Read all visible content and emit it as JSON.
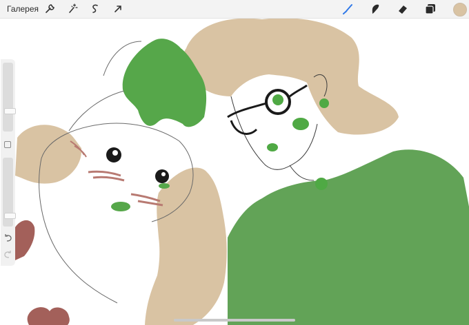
{
  "toolbar": {
    "gallery_label": "Галерея",
    "left_tools": [
      {
        "name": "wrench-icon"
      },
      {
        "name": "magic-wand-icon"
      },
      {
        "name": "selection-icon"
      },
      {
        "name": "arrow-transform-icon"
      }
    ],
    "right_tools": [
      {
        "name": "brush-icon"
      },
      {
        "name": "smudge-icon"
      },
      {
        "name": "eraser-icon"
      },
      {
        "name": "layers-icon"
      }
    ],
    "active_tool": "brush-icon",
    "current_color": "#d9c3a3"
  },
  "sidebar": {
    "brush_size_level": 0.28,
    "opacity_level": 0.12,
    "icons": [
      "modify-square-icon",
      "undo-icon",
      "redo-icon"
    ]
  },
  "colors": {
    "active_blue": "#2f78e8",
    "hair_tan": "#d9c3a3",
    "shirt_green": "#62a357",
    "hair_green": "#56a74a",
    "blush_mauve": "#a3605a"
  }
}
